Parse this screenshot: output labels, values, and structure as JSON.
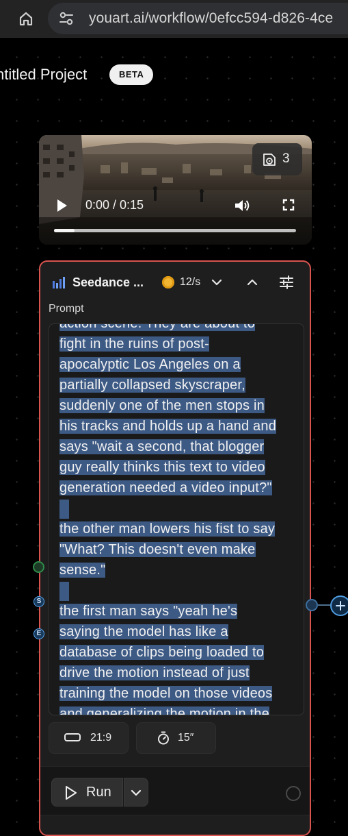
{
  "browser": {
    "url": "youart.ai/workflow/0efcc594-d826-4ce"
  },
  "project": {
    "title": "ntitled Project",
    "badge": "BETA"
  },
  "video_node": {
    "clip_count": "3",
    "time": "0:00 / 0:15",
    "progress_fraction": 0.084
  },
  "model_node": {
    "model_name": "Seedance ...",
    "credit_rate": "12/s",
    "prompt_label": "Prompt",
    "prompt_paragraphs": [
      [
        "action scene. They are about to",
        "fight in the ruins of post-",
        "apocalyptic Los Angeles on a",
        "partially collapsed skyscraper,",
        "suddenly one of the men stops in",
        "his tracks and holds up a hand and",
        "says \"wait a second, that blogger",
        "guy really thinks this text to video",
        "generation needed a video input?\""
      ],
      [
        "the other man lowers his fist to say",
        "\"What? This doesn't even make",
        "sense.\""
      ],
      [
        "the first man says \"yeah he's",
        "saying the model has like a",
        "database of clips being loaded to",
        "drive the motion instead of just",
        "training the model on those videos",
        "and generalizing the motion in the"
      ]
    ],
    "aspect_ratio": "21:9",
    "duration": "15″",
    "run_label": "Run"
  },
  "handles": {
    "s_label": "S",
    "e_label": "E"
  },
  "colors": {
    "node_border_selected": "#d9544f",
    "text_selection": "#3d5a85",
    "credit_coin": "#f2b632",
    "handle_blue": "#5aa4e8",
    "handle_green": "#2f8a4a"
  }
}
